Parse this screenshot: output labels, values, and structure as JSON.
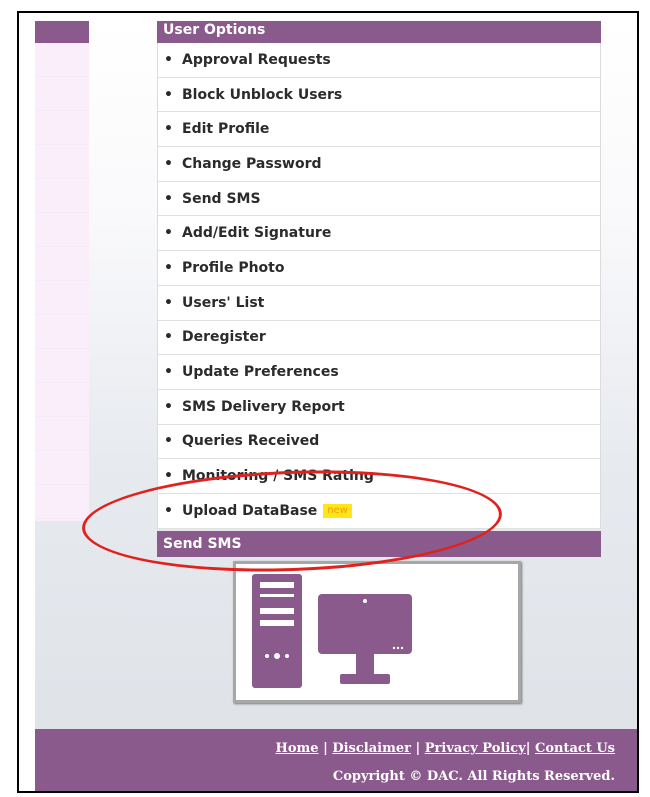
{
  "menu": {
    "header": "User Options",
    "items": [
      {
        "label": "Approval Requests"
      },
      {
        "label": "Block Unblock Users"
      },
      {
        "label": "Edit Profile"
      },
      {
        "label": "Change Password"
      },
      {
        "label": "Send SMS"
      },
      {
        "label": "Add/Edit Signature"
      },
      {
        "label": "Profile Photo"
      },
      {
        "label": "Users' List"
      },
      {
        "label": "Deregister"
      },
      {
        "label": "Update Preferences"
      },
      {
        "label": "SMS Delivery Report"
      },
      {
        "label": "Queries Received"
      },
      {
        "label": "Monitoring / SMS Rating"
      },
      {
        "label": "Upload DataBase",
        "badge": "new"
      }
    ],
    "bullet": "•"
  },
  "send_sms": {
    "header": "Send SMS"
  },
  "footer": {
    "links": [
      "Home",
      "Disclaimer",
      "Privacy Policy",
      "Contact Us"
    ],
    "separator": "|",
    "copyright": "Copyright © DAC. All Rights Reserved."
  },
  "colors": {
    "accent": "#8a5a8c",
    "badge_bg": "#ffe51a",
    "annotation": "#e0221e"
  },
  "icons": [
    "desktop-tower-icon",
    "monitor-icon"
  ]
}
